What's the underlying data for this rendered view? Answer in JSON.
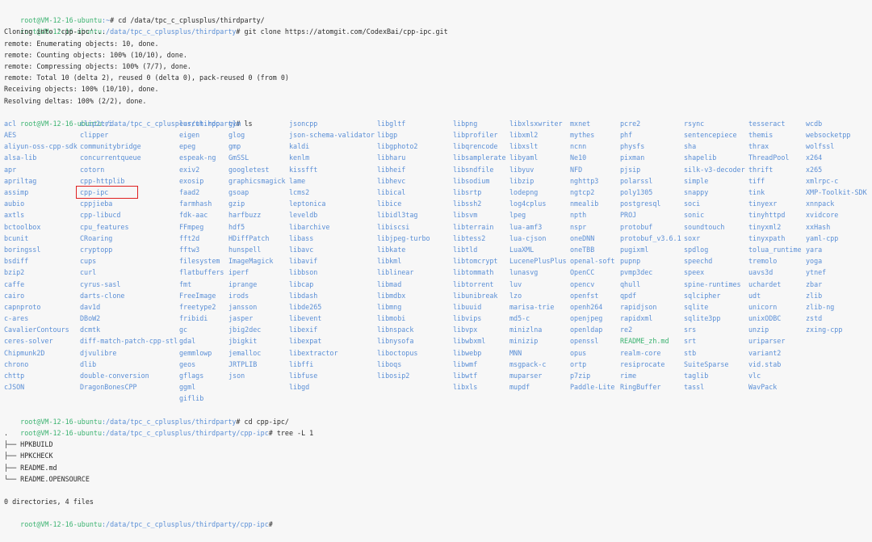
{
  "terminal": {
    "prompt_user": "root@VM-12-16-ubuntu",
    "sessions": [
      {
        "path": ":~",
        "cmd": "# cd /data/tpc_c_cplusplus/thirdparty/"
      },
      {
        "path": ":/data/tpc_c_cplusplus/thirdparty",
        "cmd": "# git clone https://atomgit.com/CodexBai/cpp-ipc.git"
      }
    ],
    "clone_output": [
      "Cloning into 'cpp-ipc'...",
      "remote: Enumerating objects: 10, done.",
      "remote: Counting objects: 100% (10/10), done.",
      "remote: Compressing objects: 100% (7/7), done.",
      "remote: Total 10 (delta 2), reused 0 (delta 0), pack-reused 0 (from 0)",
      "Receiving objects: 100% (10/10), done.",
      "Resolving deltas: 100% (2/2), done."
    ],
    "ls_prompt": {
      "path": ":/data/tpc_c_cplusplus/thirdparty",
      "cmd": "# ls"
    },
    "ls_columns": [
      [
        "acl",
        "AES",
        "aliyun-oss-cpp-sdk",
        "alsa-lib",
        "apr",
        "apriltag",
        "assimp",
        "aubio",
        "axtls",
        "bctoolbox",
        "bcunit",
        "boringssl",
        "bsdiff",
        "bzip2",
        "caffe",
        "cairo",
        "capnproto",
        "c-ares",
        "CavalierContours",
        "ceres-solver",
        "Chipmunk2D",
        "chrono",
        "chttp",
        "cJSON"
      ],
      [
        "clip2tri",
        "clipper",
        "communitybridge",
        "concurrentqueue",
        "cotorn",
        "cpp-httplib",
        "cpp-ipc",
        "cppjieba",
        "cpp-libucd",
        "cpu_features",
        "CRoaring",
        "cryptopp",
        "cups",
        "curl",
        "cyrus-sasl",
        "darts-clone",
        "dav1d",
        "DBoW2",
        "dcmtk",
        "diff-match-patch-cpp-stl",
        "djvulibre",
        "dlib",
        "double-conversion",
        "DragonBonesCPP"
      ],
      [
        "earcut.hpp",
        "eigen",
        "epeg",
        "espeak-ng",
        "exiv2",
        "exosip",
        "faad2",
        "farmhash",
        "fdk-aac",
        "FFmpeg",
        "fft2d",
        "fftw3",
        "filesystem",
        "flatbuffers",
        "fmt",
        "FreeImage",
        "freetype2",
        "fribidi",
        "gc",
        "gdal",
        "gemmlowp",
        "geos",
        "gflags",
        "ggml",
        "giflib"
      ],
      [
        "glm",
        "glog",
        "gmp",
        "GmSSL",
        "googletest",
        "graphicsmagick",
        "gsoap",
        "gzip",
        "harfbuzz",
        "hdf5",
        "HDiffPatch",
        "hunspell",
        "ImageMagick",
        "iperf",
        "iprange",
        "irods",
        "jansson",
        "jasper",
        "jbig2dec",
        "jbigkit",
        "jemalloc",
        "JRTPLIB",
        "json"
      ],
      [
        "jsoncpp",
        "json-schema-validator",
        "kaldi",
        "kenlm",
        "kissfft",
        "lame",
        "lcms2",
        "leptonica",
        "leveldb",
        "libarchive",
        "libass",
        "libavc",
        "libavif",
        "libbson",
        "libcap",
        "libdash",
        "libde265",
        "libevent",
        "libexif",
        "libexpat",
        "libextractor",
        "libffi",
        "libfuse",
        "libgd"
      ],
      [
        "libgltf",
        "libgp",
        "libgphoto2",
        "libharu",
        "libheif",
        "libhevc",
        "libical",
        "libice",
        "libidl3tag",
        "libiscsi",
        "libjpeg-turbo",
        "libkate",
        "libkml",
        "liblinear",
        "libmad",
        "libmdbx",
        "libmng",
        "libmobi",
        "libnspack",
        "libnysofa",
        "liboctopus",
        "liboqs",
        "libosip2"
      ],
      [
        "libpng",
        "libprofiler",
        "libqrencode",
        "libsamplerate",
        "libsndfile",
        "libsodium",
        "libsrtp",
        "libssh2",
        "libsvm",
        "libterrain",
        "libtess2",
        "libtld",
        "libtomcrypt",
        "libtommath",
        "libtorrent",
        "libunibreak",
        "libuuid",
        "libvips",
        "libvpx",
        "libwbxml",
        "libwebp",
        "libwmf",
        "libwtf",
        "libxls"
      ],
      [
        "libxlsxwriter",
        "libxml2",
        "libxslt",
        "libyaml",
        "libyuv",
        "libzip",
        "lodepng",
        "log4cplus",
        "lpeg",
        "lua-amf3",
        "lua-cjson",
        "LuaXML",
        "LucenePlusPlus",
        "lunasvg",
        "luv",
        "lzo",
        "marisa-trie",
        "md5-c",
        "minizlna",
        "minizip",
        "MNN",
        "msgpack-c",
        "muparser",
        "mupdf"
      ],
      [
        "mxnet",
        "mythes",
        "ncnn",
        "Ne10",
        "NFD",
        "nghttp3",
        "ngtcp2",
        "nmealib",
        "npth",
        "nspr",
        "oneDNN",
        "oneTBB",
        "openal-soft",
        "OpenCC",
        "opencv",
        "openfst",
        "openh264",
        "openjpeg",
        "openldap",
        "openssl",
        "opus",
        "ortp",
        "p7zip",
        "Paddle-Lite"
      ],
      [
        "pcre2",
        "phf",
        "physfs",
        "pixman",
        "pjsip",
        "polarssl",
        "poly1305",
        "postgresql",
        "PROJ",
        "protobuf",
        "protobuf_v3.6.1",
        "pugixml",
        "pupnp",
        "pvmp3dec",
        "qhull",
        "qpdf",
        "rapidjson",
        "rapidxml",
        "re2",
        "README_zh.md",
        "realm-core",
        "resiprocate",
        "rime",
        "RingBuffer"
      ],
      [
        "rsync",
        "sentencepiece",
        "sha",
        "shapelib",
        "silk-v3-decoder",
        "simple",
        "snappy",
        "soci",
        "sonic",
        "soundtouch",
        "soxr",
        "spdlog",
        "speechd",
        "speex",
        "spine-runtimes",
        "sqlcipher",
        "sqlite",
        "sqlite3pp",
        "srs",
        "srt",
        "stb",
        "SuiteSparse",
        "taglib",
        "tassl"
      ],
      [
        "tesseract",
        "themis",
        "thrax",
        "ThreadPool",
        "thrift",
        "tiff",
        "tink",
        "tinyexr",
        "tinyhttpd",
        "tinyxml2",
        "tinyxpath",
        "tolua_runtime",
        "tremolo",
        "uavs3d",
        "uchardet",
        "udt",
        "unicorn",
        "unixODBC",
        "unzip",
        "uriparser",
        "variant2",
        "vid.stab",
        "vlc",
        "WavPack"
      ],
      [
        "wcdb",
        "websocketpp",
        "wolfssl",
        "x264",
        "x265",
        "xmlrpc-c",
        "XMP-Toolkit-SDK",
        "xnnpack",
        "xvidcore",
        "xxHash",
        "yaml-cpp",
        "yara",
        "yoga",
        "ytnef",
        "zbar",
        "zlib",
        "zlib-ng",
        "zstd",
        "zxing-cpp"
      ]
    ],
    "ls_file_entries": [
      "README_zh.md"
    ],
    "cd_prompt": {
      "path": ":/data/tpc_c_cplusplus/thirdparty",
      "cmd": "# cd cpp-ipc/"
    },
    "tree_prompt": {
      "path": ":/data/tpc_c_cplusplus/thirdparty/cpp-ipc",
      "cmd": "# tree -L 1"
    },
    "tree_output": [
      ".",
      "├── HPKBUILD",
      "├── HPKCHECK",
      "├── README.md",
      "└── README.OPENSOURCE",
      "",
      "0 directories, 4 files"
    ],
    "final_prompt": {
      "path": ":/data/tpc_c_cplusplus/thirdparty/cpp-ipc",
      "cmd": "#"
    },
    "highlighted_entry": "cpp-ipc"
  },
  "colors": {
    "background": "#f7f7f7",
    "user": "#3cb371",
    "path": "#5b8fd6",
    "text": "#2b2b2b",
    "highlight": "#e02020"
  }
}
